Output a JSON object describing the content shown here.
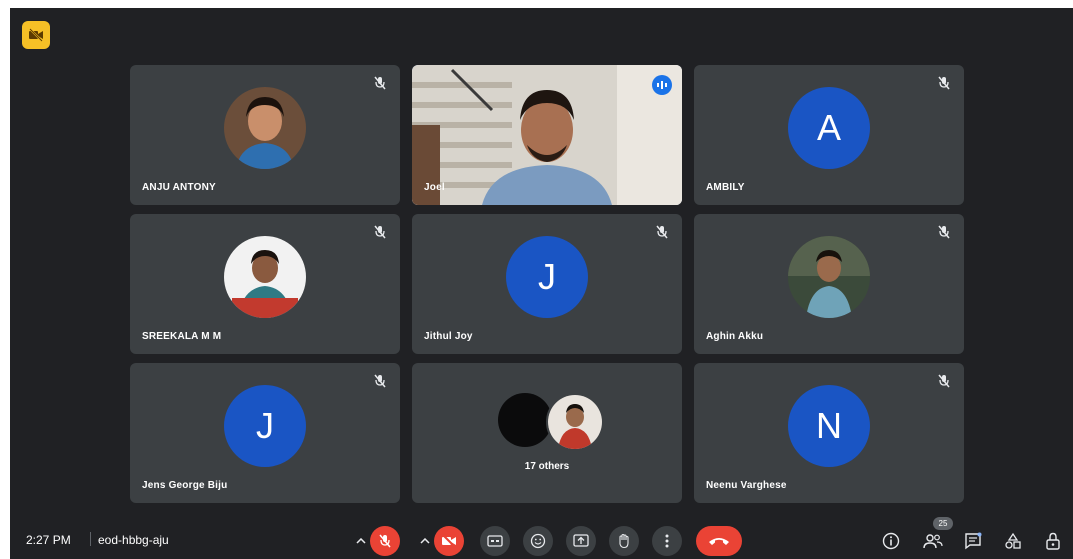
{
  "participants": [
    {
      "name": "ANJU ANTONY",
      "type": "photo",
      "muted": true
    },
    {
      "name": "Joel",
      "type": "video",
      "speaking": true
    },
    {
      "name": "AMBILY",
      "type": "letter",
      "initial": "A",
      "muted": true
    },
    {
      "name": "SREEKALA M M",
      "type": "photo",
      "muted": true
    },
    {
      "name": "Jithul Joy",
      "type": "letter",
      "initial": "J",
      "muted": true
    },
    {
      "name": "Aghin Akku",
      "type": "photo",
      "muted": true
    },
    {
      "name": "Jens George Biju",
      "type": "letter",
      "initial": "J",
      "muted": true
    },
    {
      "name": "",
      "type": "others"
    },
    {
      "name": "Neenu Varghese",
      "type": "letter",
      "initial": "N",
      "muted": true
    }
  ],
  "others_label": "17 others",
  "bottom_bar": {
    "time": "2:27 PM",
    "meeting_code": "eod-hbbg-aju",
    "participant_count": "25"
  },
  "colors": {
    "background": "#202124",
    "tile": "#3c4043",
    "avatar_blue": "#1a55c4",
    "end_call_red": "#ea4335",
    "speaking_border": "#8ab4f8",
    "badge_yellow": "#f6c026"
  },
  "icons": [
    "cam-off-icon",
    "mic-off-icon",
    "more-vert-icon",
    "captions-icon",
    "emoji-icon",
    "present-icon",
    "raise-hand-icon",
    "end-call-icon",
    "info-icon",
    "people-icon",
    "chat-icon",
    "activities-icon",
    "host-controls-icon"
  ]
}
